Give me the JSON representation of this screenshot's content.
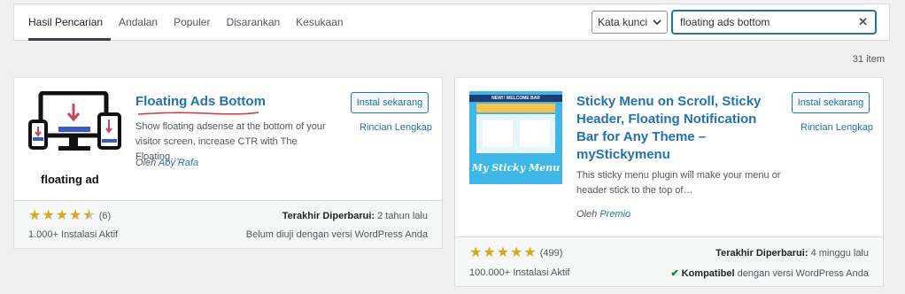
{
  "tabs": [
    {
      "label": "Hasil Pencarian",
      "active": true
    },
    {
      "label": "Andalan"
    },
    {
      "label": "Populer"
    },
    {
      "label": "Disarankan"
    },
    {
      "label": "Kesukaan"
    }
  ],
  "search": {
    "type_label": "Kata kunci",
    "value": "floating ads bottom"
  },
  "item_count": "31 item",
  "plugins": [
    {
      "title": "Floating Ads Bottom",
      "description": "Show floating adsense at the bottom of your visitor screen, increase CTR with The Floating…",
      "author_prefix": "Oleh",
      "author": "Aby Rafa",
      "install_label": "Instal sekarang",
      "details_label": "Rincian Lengkap",
      "icon_caption": "floating ad",
      "rating": 4.5,
      "rating_count": "(6)",
      "installs": "1.000+ Instalasi Aktif",
      "updated_label": "Terakhir Diperbarui:",
      "updated_value": "2 tahun lalu",
      "compat": "Belum diuji dengan versi WordPress Anda"
    },
    {
      "title": "Sticky Menu on Scroll, Sticky Header, Floating Notification Bar for Any Theme – myStickymenu",
      "title_lines": [
        "Sticky Menu on Scroll, Sticky",
        "Header, Floating Notification",
        "Bar for Any Theme –",
        "myStickymenu"
      ],
      "description": "This sticky menu plugin will make your menu or header stick to the top of…",
      "author_prefix": "Oleh",
      "author": "Premio",
      "install_label": "Instal sekarang",
      "details_label": "Rincian Lengkap",
      "icon_banner": "NEW!! WELCOME BAR",
      "icon_caption": "My Sticky Menu",
      "rating": 5,
      "rating_count": "(499)",
      "installs": "100.000+ Instalasi Aktif",
      "updated_label": "Terakhir Diperbarui:",
      "updated_value": "4 minggu lalu",
      "compat_strong": "Kompatibel",
      "compat": "dengan versi WordPress Anda"
    }
  ]
}
